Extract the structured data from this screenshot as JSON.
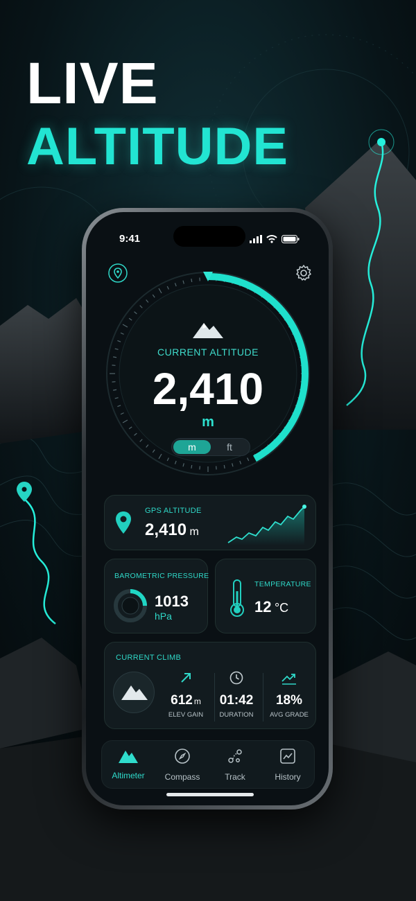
{
  "headline": {
    "line1": "LIVE",
    "line2": "ALTITUDE"
  },
  "status_bar": {
    "time": "9:41"
  },
  "gauge": {
    "label": "CURRENT ALTITUDE",
    "value": "2,410",
    "unit": "m",
    "arc_fraction": 0.42
  },
  "unit_toggle": {
    "options": [
      "m",
      "ft"
    ],
    "selected": "m"
  },
  "gps": {
    "label": "GPS ALTITUDE",
    "value": "2,410",
    "unit": "m"
  },
  "pressure": {
    "label": "BAROMETRIC PRESSURE",
    "value": "1013",
    "unit": "hPa"
  },
  "temperature": {
    "label": "TEMPERATURE",
    "value": "12",
    "unit": "°C"
  },
  "climb": {
    "label": "CURRENT CLIMB",
    "stats": [
      {
        "icon": "arrow-up-right-icon",
        "value": "612",
        "unit": "m",
        "label": "ELEV GAIN"
      },
      {
        "icon": "clock-icon",
        "value": "01:42",
        "unit": "",
        "label": "DURATION"
      },
      {
        "icon": "trend-icon",
        "value": "18%",
        "unit": "",
        "label": "AVG GRADE"
      }
    ]
  },
  "nav": [
    {
      "label": "Altimeter",
      "icon": "mountain-icon",
      "active": true
    },
    {
      "label": "Compass",
      "icon": "compass-icon",
      "active": false
    },
    {
      "label": "Track",
      "icon": "track-icon",
      "active": false
    },
    {
      "label": "History",
      "icon": "history-chart-icon",
      "active": false
    }
  ],
  "colors": {
    "accent": "#22e4d2",
    "background": "#0a1014",
    "card": "#121b1f"
  }
}
